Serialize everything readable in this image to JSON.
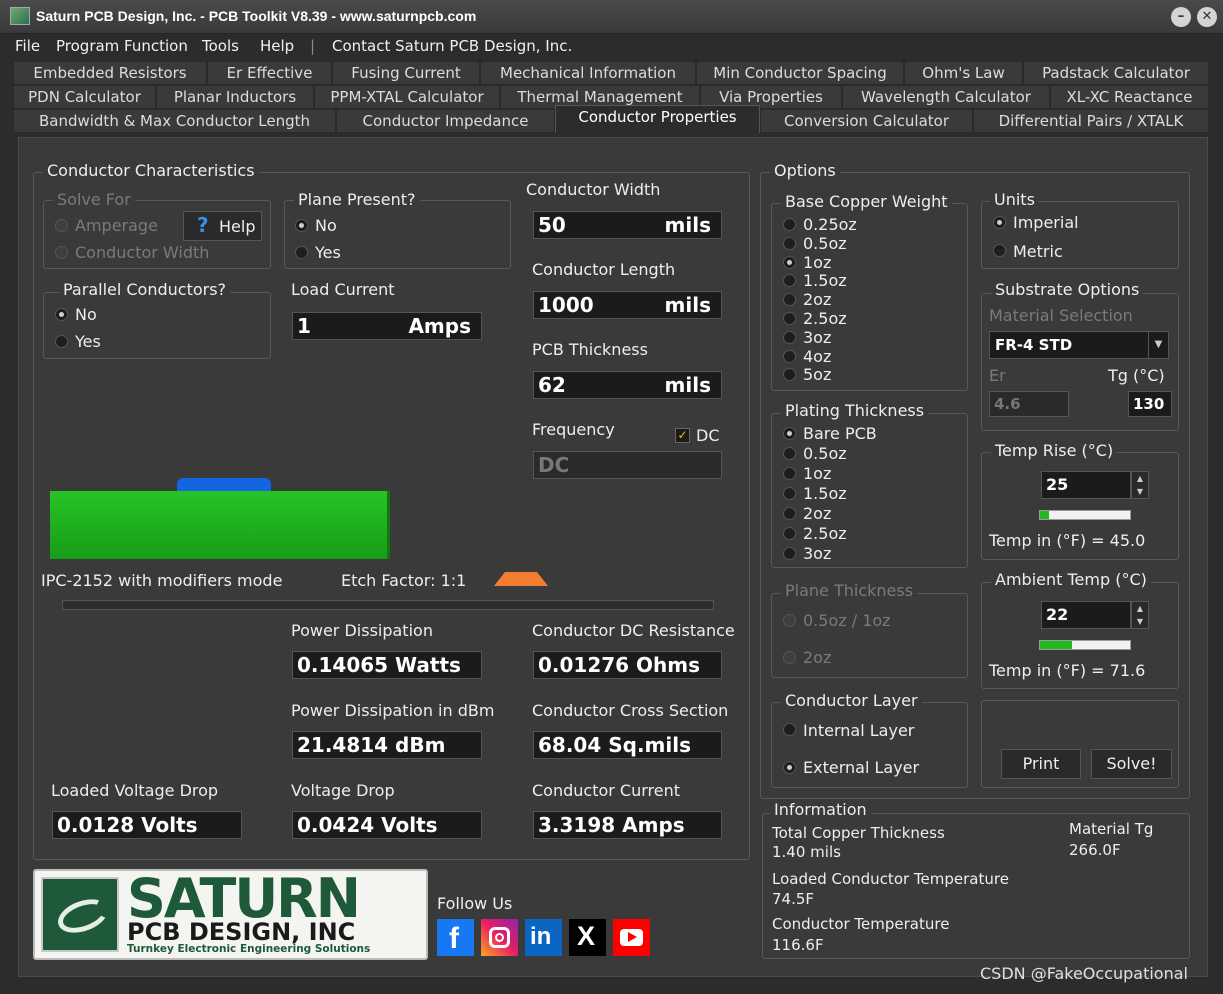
{
  "window": {
    "title": "Saturn PCB Design, Inc. - PCB Toolkit V8.39 - www.saturnpcb.com",
    "min": "–",
    "close": "✕"
  },
  "menu": {
    "items": [
      "File",
      "Program Function",
      "Tools",
      "Help"
    ],
    "separator": "|",
    "contact": "Contact Saturn PCB Design, Inc."
  },
  "tabs": {
    "row1": [
      "Embedded Resistors",
      "Er Effective",
      "Fusing Current",
      "Mechanical Information",
      "Min Conductor Spacing",
      "Ohm's Law",
      "Padstack Calculator"
    ],
    "row2": [
      "PDN Calculator",
      "Planar Inductors",
      "PPM-XTAL Calculator",
      "Thermal Management",
      "Via Properties",
      "Wavelength Calculator",
      "XL-XC Reactance"
    ],
    "row3": [
      "Bandwidth & Max Conductor Length",
      "Conductor Impedance",
      "Conductor Properties",
      "Conversion Calculator",
      "Differential Pairs / XTALK"
    ],
    "active": "Conductor Properties"
  },
  "conductor": {
    "title": "Conductor Characteristics",
    "solve_for": {
      "title": "Solve For",
      "amperage": "Amperage",
      "width": "Conductor Width",
      "help": "Help",
      "help_icon": "?"
    },
    "plane": {
      "title": "Plane Present?",
      "no": "No",
      "yes": "Yes"
    },
    "parallel": {
      "title": "Parallel Conductors?",
      "no": "No",
      "yes": "Yes"
    },
    "load_current": {
      "label": "Load Current",
      "value": "1",
      "unit": "Amps"
    },
    "width": {
      "label": "Conductor Width",
      "value": "50",
      "unit": "mils"
    },
    "length": {
      "label": "Conductor Length",
      "value": "1000",
      "unit": "mils"
    },
    "thickness": {
      "label": "PCB Thickness",
      "value": "62",
      "unit": "mils"
    },
    "frequency": {
      "label": "Frequency",
      "dc_label": "DC",
      "value": "DC",
      "dc_check": "✓"
    },
    "mode": "IPC-2152 with modifiers mode",
    "etch": "Etch Factor: 1:1",
    "colors": {
      "board": "#1fb51f",
      "trace": "#1565e0",
      "etch": "#f27d30"
    }
  },
  "results": {
    "power": {
      "label": "Power Dissipation",
      "value": "0.14065 Watts"
    },
    "resistance": {
      "label": "Conductor DC Resistance",
      "value": "0.01276 Ohms"
    },
    "power_dbm": {
      "label": "Power Dissipation in dBm",
      "value": "21.4814 dBm"
    },
    "cross": {
      "label": "Conductor Cross Section",
      "value": "68.04 Sq.mils"
    },
    "loaded_drop": {
      "label": "Loaded Voltage Drop",
      "value": "0.0128 Volts"
    },
    "drop": {
      "label": "Voltage Drop",
      "value": "0.0424 Volts"
    },
    "current": {
      "label": "Conductor Current",
      "value": "3.3198 Amps"
    }
  },
  "options": {
    "title": "Options",
    "base_copper": {
      "title": "Base Copper Weight",
      "items": [
        "0.25oz",
        "0.5oz",
        "1oz",
        "1.5oz",
        "2oz",
        "2.5oz",
        "3oz",
        "4oz",
        "5oz"
      ],
      "selected": "1oz"
    },
    "plating": {
      "title": "Plating Thickness",
      "items": [
        "Bare PCB",
        "0.5oz",
        "1oz",
        "1.5oz",
        "2oz",
        "2.5oz",
        "3oz"
      ],
      "selected": "Bare PCB"
    },
    "plane_thickness": {
      "title": "Plane Thickness",
      "items": [
        "0.5oz / 1oz",
        "2oz"
      ]
    },
    "layer": {
      "title": "Conductor Layer",
      "internal": "Internal Layer",
      "external": "External Layer"
    },
    "units": {
      "title": "Units",
      "imperial": "Imperial",
      "metric": "Metric"
    },
    "substrate": {
      "title": "Substrate Options",
      "material_label": "Material Selection",
      "material": "FR-4 STD",
      "er_label": "Er",
      "er": "4.6",
      "tg_label": "Tg (°C)",
      "tg": "130"
    },
    "temp_rise": {
      "title": "Temp Rise (°C)",
      "value": "25",
      "fahrenheit": "Temp in (°F) = 45.0",
      "level_pct": 10
    },
    "ambient": {
      "title": "Ambient Temp (°C)",
      "value": "22",
      "fahrenheit": "Temp in (°F) = 71.6",
      "level_pct": 35
    },
    "print": "Print",
    "solve": "Solve!"
  },
  "info": {
    "title": "Information",
    "copper_label": "Total Copper Thickness",
    "copper": "1.40 mils",
    "material_tg_label": "Material Tg",
    "material_tg": "266.0F",
    "loaded_label": "Loaded Conductor Temperature",
    "loaded": "74.5F",
    "temp_label": "Conductor Temperature",
    "temp": "116.6F"
  },
  "logo": {
    "name": "SATURN",
    "sub": "PCB DESIGN, INC",
    "tagline": "Turnkey Electronic Engineering Solutions"
  },
  "follow": "Follow Us",
  "watermark": "CSDN @FakeOccupational"
}
